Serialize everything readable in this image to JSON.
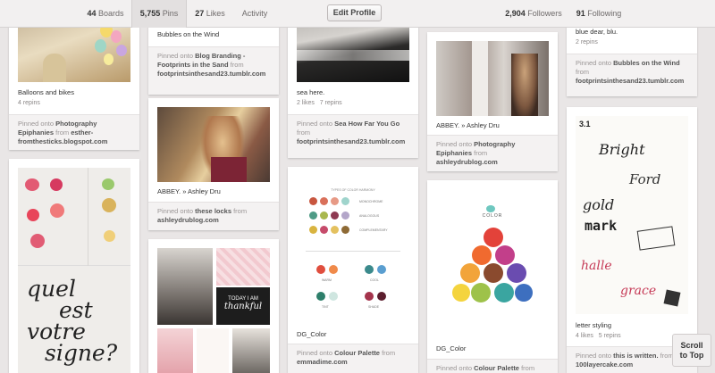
{
  "nav": {
    "boards_count": "44",
    "boards_label": "Boards",
    "pins_count": "5,755",
    "pins_label": "Pins",
    "likes_count": "27",
    "likes_label": "Likes",
    "activity_label": "Activity",
    "edit_profile": "Edit Profile",
    "followers_count": "2,904",
    "followers_label": "Followers",
    "following_count": "91",
    "following_label": "Following"
  },
  "pins": {
    "balloons": {
      "desc": "Balloons and bikes",
      "repins": "4 repins",
      "pinned_onto": "Pinned onto",
      "board": "Photography Epiphanies",
      "from": "from",
      "source": "esther-fromthesticks.blogspot.com"
    },
    "bubbles_top": {
      "desc": "Bubbles on the Wind",
      "pinned_onto": "Pinned onto",
      "board": "Blog Branding - Footprints in the Sand",
      "from": "from",
      "source": "footprintsinthesand23.tumblr.com"
    },
    "sea": {
      "desc": "sea here.",
      "likes": "2 likes",
      "repins": "7 repins",
      "pinned_onto": "Pinned onto",
      "board": "Sea How Far You Go",
      "from": "from",
      "source": "footprintsinthesand23.tumblr.com"
    },
    "abbey_window": {
      "desc": "ABBEY. » Ashley Dru",
      "pinned_onto": "Pinned onto",
      "board": "Photography Epiphanies",
      "from": "from",
      "source": "ashleydrublog.com"
    },
    "blue_dear": {
      "desc": "blue dear, blu.",
      "repins": "2 repins",
      "pinned_onto": "Pinned onto",
      "board": "Bubbles on the Wind",
      "from": "from",
      "source": "footprintsinthesand23.tumblr.com"
    },
    "abbey_hair": {
      "desc": "ABBEY. » Ashley Dru",
      "pinned_onto": "Pinned onto",
      "board": "these locks",
      "from": "from",
      "source": "ashleydrublog.com"
    },
    "quel_est": {
      "art_line1": "quel",
      "art_line2": "est",
      "art_line3": "votre",
      "art_line4": "signe?"
    },
    "collage": {
      "today_line1": "TODAY I AM",
      "today_line2": "thankful"
    },
    "dg_color_1": {
      "desc": "DG_Color",
      "pinned_onto": "Pinned onto",
      "board": "Colour Palette",
      "from": "from",
      "source": "emmadime.com",
      "swatch_heading": "TYPES OF COLOR HARMONY",
      "label_mono": "MONOCHROME",
      "label_analogous": "ANALOGOUS",
      "label_complementary": "COMPLEMENTARY",
      "label_warm": "WARM",
      "label_cool": "COOL",
      "label_tint": "TINT",
      "label_shade": "SHADE"
    },
    "dg_color_2": {
      "desc": "DG_Color",
      "pinned_onto": "Pinned onto",
      "board": "Colour Palette",
      "from": "from",
      "wheel_title": "COLOR"
    },
    "letter_styling": {
      "desc": "letter styling",
      "likes": "4 likes",
      "repins": "5 repins",
      "pinned_onto": "Pinned onto",
      "board": "this is written.",
      "from": "from",
      "source": "100layercake.com",
      "art_num": "3.1",
      "art_line1": "Bright",
      "art_line2": "Ford",
      "art_line3": "gold",
      "art_line4": "mark",
      "art_line5": "halle",
      "art_line6": "grace"
    }
  },
  "scroll_top": {
    "line1": "Scroll",
    "line2": "to Top"
  },
  "colors": {
    "page_bg": "#e9e6e6",
    "topbar_bg": "#f2f0f0",
    "card_bg": "#ffffff",
    "footer_bg": "#f4f2f2"
  }
}
